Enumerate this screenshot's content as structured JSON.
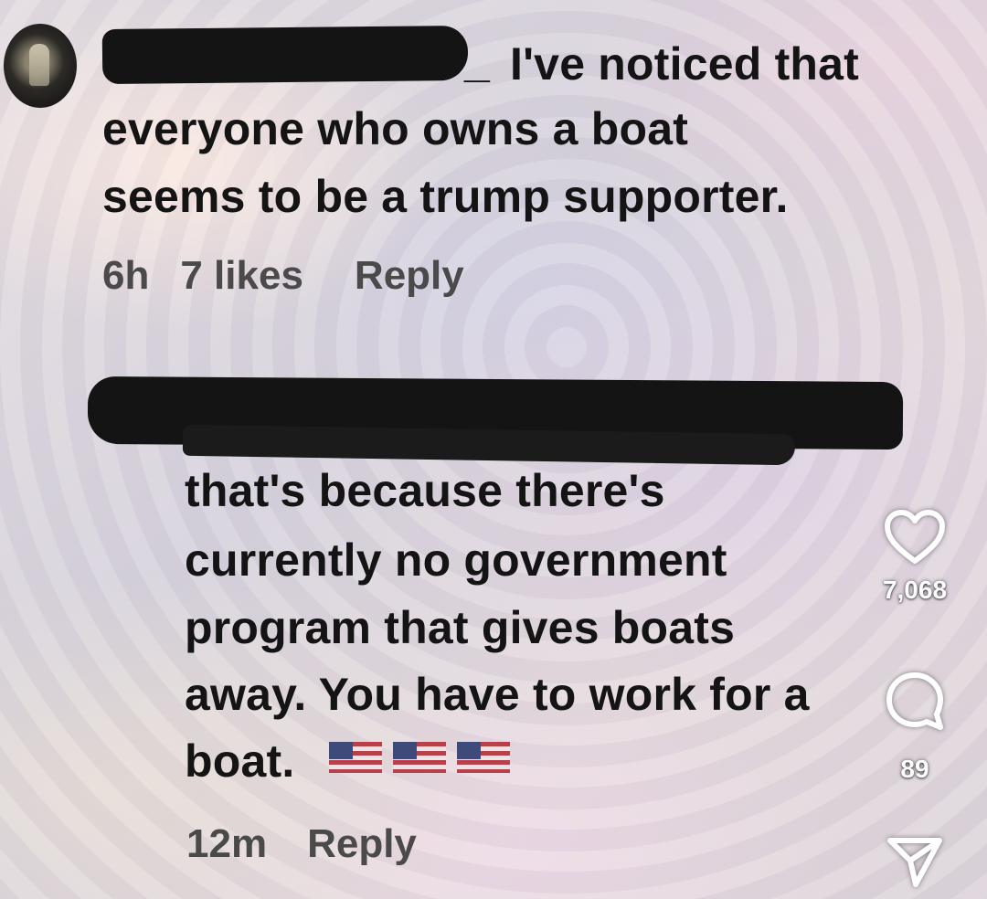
{
  "post": {
    "comment1": {
      "lines": [
        "I've noticed that",
        "everyone who owns a boat",
        "seems to be a trump supporter."
      ],
      "underscore": "_",
      "time": "6h",
      "likes": "7 likes",
      "reply_label": "Reply"
    },
    "comment2": {
      "lines": [
        "that's because there's",
        "currently no government",
        "program that gives boats",
        "away. You have to work for a",
        "boat."
      ],
      "time": "12m",
      "reply_label": "Reply"
    }
  },
  "actions": {
    "like_count": "7,068",
    "comment_count": "89",
    "icons": {
      "like": "heart-icon",
      "comment": "comment-bubble-icon",
      "share": "send-icon"
    }
  },
  "colors": {
    "text": "#141414",
    "meta_text": "#4a4a4a",
    "overlay_icon": "#ffffff"
  }
}
